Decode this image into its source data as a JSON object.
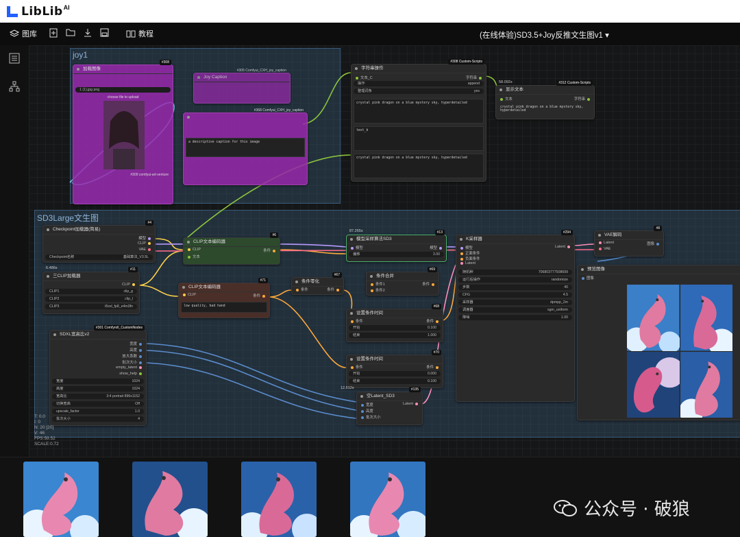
{
  "brand": {
    "name": "LibLib",
    "suffix": "AI"
  },
  "menu": {
    "library": "图库",
    "tutorial": "教程"
  },
  "workflow_title": "(在线体验)SD3.5+Joy反推文生图v1",
  "groups": {
    "joy": "joy1",
    "sd3": "SD3Large文生图"
  },
  "nodes": {
    "load_image": {
      "title": "加载图像",
      "id": "#308",
      "row1": "1 (1).jpg png",
      "upload": "choose file to upload",
      "footer": "#309 comfyui-art-venture"
    },
    "joy_caption": {
      "title": "#305 Comfyui_CXH_joy_caption",
      "sub": "Joy Caption"
    },
    "joy_caption2": {
      "title": "#368 Comfyui_CXH_joy_caption",
      "prompt": "a descriptive caption for this image"
    },
    "string_op": {
      "title": "字符串操作",
      "badge": "#308 Custom-Scripts",
      "in": "文本_C",
      "op_label": "操作",
      "op_val": "append",
      "label2": "整理词条",
      "val2": "yes",
      "out": "字符串",
      "text1": "crystal pink dragon on a blue mystery sky, hyperdetailed",
      "text2": "text_b",
      "text3": "crystal pink dragon on a blue mystery sky, hyperdetailed"
    },
    "show_text": {
      "title": "显示文本",
      "badge": "#312 Custom-Scripts",
      "time": "58.092s",
      "in": "文本",
      "out": "字符串",
      "text": "crystal pink dragon on a blue mystery sky, hyperdetailed"
    },
    "ckpt": {
      "title": "Checkpoint加载器(简易)",
      "id": "#4",
      "out1": "模型",
      "out2": "CLIP",
      "out3": "VAE",
      "label": "Checkpoint名称",
      "value": "基础算法_V3.5L"
    },
    "triple_clip": {
      "title": "三CLIP加载器",
      "id": "#11",
      "time": "6.486s",
      "out": "CLIP",
      "rows": [
        [
          "CLIP1",
          "clip_g"
        ],
        [
          "CLIP2",
          "clip_l"
        ],
        [
          "CLIP3",
          "t5xxl_fp8_e4m3fn"
        ]
      ]
    },
    "clip_pos": {
      "title": "CLIP文本编码器",
      "id": "#6",
      "in1": "CLIP",
      "in2": "文本",
      "out": "条件"
    },
    "clip_neg": {
      "title": "CLIP文本编码器",
      "id": "#71",
      "in": "CLIP",
      "out": "条件",
      "text": "low quality, bad hand"
    },
    "cond_zero": {
      "title": "条件零化",
      "id": "#67",
      "in": "条件",
      "out": "条件"
    },
    "cond_combine": {
      "title": "条件合并",
      "id": "#69",
      "in1": "条件1",
      "in2": "条件2",
      "out": "条件"
    },
    "set_time1": {
      "title": "设置条件时间",
      "id": "#68",
      "in": "条件",
      "out": "条件",
      "r1": [
        "开始",
        "0.100"
      ],
      "r2": [
        "结束",
        "1.000"
      ]
    },
    "set_time2": {
      "title": "设置条件时间",
      "id": "#70",
      "in": "条件",
      "out": "条件",
      "r1": [
        "开始",
        "0.000"
      ],
      "r2": [
        "结束",
        "0.100"
      ]
    },
    "model_sampling": {
      "title": "模型采样算法SD3",
      "id": "#13",
      "time": "87.265s",
      "in": "模型",
      "out": "模型",
      "label": "偏移",
      "value": "3.00"
    },
    "ksampler": {
      "title": "K采样器",
      "id": "#294",
      "ins": [
        "模型",
        "正面条件",
        "负面条件",
        "Latent"
      ],
      "out": "Latent",
      "rows": [
        [
          "随机种",
          "706803777508699"
        ],
        [
          "运行后操作",
          "randomize"
        ],
        [
          "步数",
          "40"
        ],
        [
          "CFG",
          "4.5"
        ],
        [
          "采样器",
          "dpmpp_2m"
        ],
        [
          "调度器",
          "sgm_uniform"
        ],
        [
          "降噪",
          "1.00"
        ]
      ]
    },
    "vae_decode": {
      "title": "VAE解码",
      "id": "#8",
      "in1": "Latent",
      "in2": "VAE",
      "out": "图像"
    },
    "preview": {
      "title": "预览图像",
      "in": "图像"
    },
    "sdxl_res": {
      "title": "SDXL宽高比v2",
      "badge": "#301 Comfyroll_CustomNodes",
      "outs": [
        "宽度",
        "高度",
        "放大系数",
        "批次大小",
        "empty_latent",
        "show_help"
      ],
      "rows": [
        [
          "宽度",
          "1024"
        ],
        [
          "高度",
          "1024"
        ],
        [
          "宽高比",
          "3:4 portrait 896x1152"
        ],
        [
          "切换宽高",
          "Off"
        ],
        [
          "upscale_factor",
          "1.0"
        ],
        [
          "批次大小",
          "4"
        ]
      ]
    },
    "empty_latent": {
      "title": "空Latent_SD3",
      "id": "#135",
      "time": "12.612s",
      "ins": [
        "宽度",
        "高度",
        "批次大小"
      ],
      "out": "Latent"
    }
  },
  "stats": [
    "T: 0.0",
    "I: 0",
    "N: 20 [20]",
    "V: 46",
    "FPS:59.52",
    "SCALE:0.72"
  ],
  "watermark": "公众号 · 破狼"
}
